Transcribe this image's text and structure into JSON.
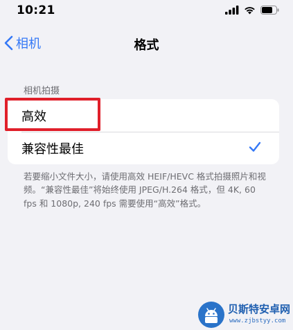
{
  "status_bar": {
    "time": "10:21"
  },
  "nav": {
    "back_label": "相机",
    "title": "格式"
  },
  "section": {
    "header": "相机拍摄",
    "options": [
      {
        "label": "高效",
        "selected": false
      },
      {
        "label": "兼容性最佳",
        "selected": true
      }
    ]
  },
  "footer_note": "若要缩小文件大小，请使用高效 HEIF/HEVC 格式拍摄照片和视频。“兼容性最佳”将始终使用 JPEG/H.264 格式，但 4K, 60 fps 和 1080p, 240 fps 需要使用“高效”格式。",
  "watermark": {
    "title": "贝斯特安卓网",
    "url": "www.zjbstyy.com"
  },
  "colors": {
    "accent": "#3478f6",
    "highlight": "#e01f2a",
    "background": "#f2f2f6"
  }
}
